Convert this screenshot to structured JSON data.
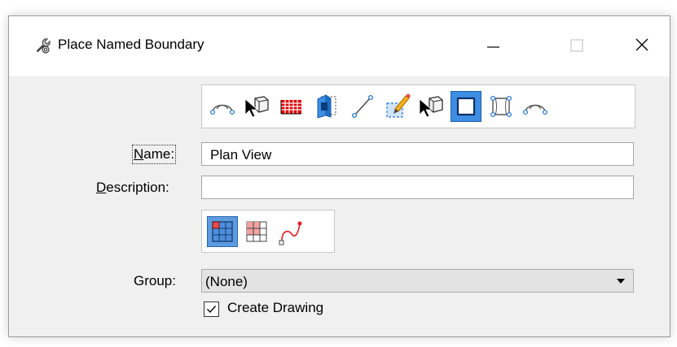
{
  "window": {
    "title": "Place Named Boundary",
    "app_icon": "wrench-gear-icon",
    "controls": [
      "minimize-icon",
      "maximize-icon",
      "close-icon"
    ]
  },
  "toolbar": {
    "selected_index": 8,
    "tools": [
      {
        "name": "from-element-icon"
      },
      {
        "name": "from-element-pick-icon"
      },
      {
        "name": "grid-icon"
      },
      {
        "name": "volume-icon"
      },
      {
        "name": "line-icon"
      },
      {
        "name": "draw-boundary-icon"
      },
      {
        "name": "pick-element-icon"
      },
      {
        "name": "rectangle-boundary-icon"
      },
      {
        "name": "shape-boundary-icon"
      },
      {
        "name": "from-element-alt-icon"
      }
    ]
  },
  "form": {
    "name_label_prefix": "N",
    "name_label_rest": "ame:",
    "name_value": "Plan View",
    "description_label_prefix": "D",
    "description_label_rest": "escription:",
    "description_value": "",
    "group_label": "Group:",
    "group_value": "(None)",
    "create_drawing_label": "Create Drawing",
    "create_drawing_checked": true
  },
  "modes": {
    "selected_index": 0,
    "items": [
      {
        "name": "grid-mode-blue-icon"
      },
      {
        "name": "grid-mode-red-icon"
      },
      {
        "name": "curve-mode-icon"
      }
    ]
  }
}
